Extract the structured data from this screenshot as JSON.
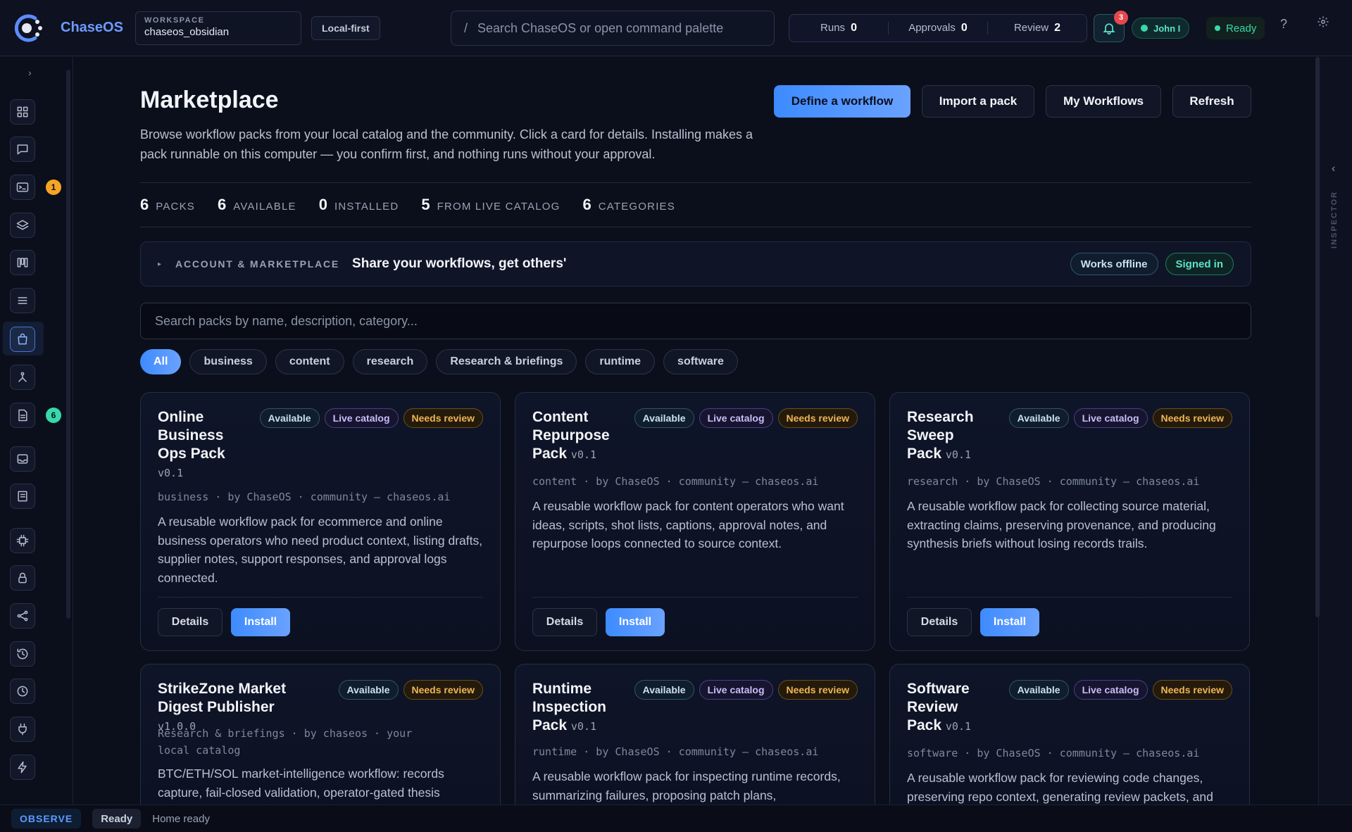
{
  "app": {
    "name": "ChaseOS"
  },
  "workspace": {
    "label": "WORKSPACE",
    "value": "chaseos_obsidian"
  },
  "mode_pill": "Local-first",
  "command": {
    "slash": "/",
    "placeholder": "Search ChaseOS or open command palette"
  },
  "counters": [
    {
      "label": "Runs",
      "value": "0"
    },
    {
      "label": "Approvals",
      "value": "0"
    },
    {
      "label": "Review",
      "value": "2"
    }
  ],
  "notifications": {
    "count": "3"
  },
  "user": {
    "name": "John I"
  },
  "status": {
    "label": "Ready"
  },
  "help": "?",
  "sidebar": {
    "toggle": "›",
    "items": [
      {
        "icon": "grid-icon"
      },
      {
        "icon": "chat-icon"
      },
      {
        "icon": "terminal-icon",
        "badge": "1",
        "badge_color": "#f5a524"
      },
      {
        "icon": "layers-icon"
      },
      {
        "icon": "kanban-icon"
      },
      {
        "icon": "list-icon"
      },
      {
        "icon": "shopping-bag-icon",
        "active": true
      },
      {
        "icon": "graph-icon"
      },
      {
        "icon": "document-icon",
        "badge": "6",
        "badge_color": "#38d9a9"
      },
      {
        "icon": "inbox-icon"
      },
      {
        "icon": "notebook-icon"
      },
      {
        "icon": "chip-icon"
      },
      {
        "icon": "lock-icon"
      },
      {
        "icon": "share-icon"
      },
      {
        "icon": "history-icon"
      },
      {
        "icon": "clock-icon"
      },
      {
        "icon": "plug-icon"
      },
      {
        "icon": "bolt-icon"
      }
    ]
  },
  "inspector": {
    "label": "INSPECTOR",
    "collapse": "‹"
  },
  "page": {
    "title": "Marketplace",
    "description": "Browse workflow packs from your local catalog and the community. Click a card for details. Installing makes a pack runnable on this computer — you confirm first, and nothing runs without your approval.",
    "actions": {
      "define": "Define a workflow",
      "import": "Import a pack",
      "my": "My Workflows",
      "refresh": "Refresh"
    },
    "stats": [
      {
        "value": "6",
        "label": "PACKS"
      },
      {
        "value": "6",
        "label": "AVAILABLE"
      },
      {
        "value": "0",
        "label": "INSTALLED"
      },
      {
        "value": "5",
        "label": "FROM LIVE CATALOG"
      },
      {
        "value": "6",
        "label": "CATEGORIES"
      }
    ],
    "account": {
      "caret": "▸",
      "label": "ACCOUNT & MARKETPLACE",
      "title": "Share your workflows, get others'",
      "tags": [
        "Works offline",
        "Signed in"
      ]
    },
    "search_placeholder": "Search packs by name, description, category...",
    "filters": [
      "All",
      "business",
      "content",
      "research",
      "Research & briefings",
      "runtime",
      "software"
    ],
    "active_filter": "All"
  },
  "cards": [
    {
      "title": "Online Business Ops Pack",
      "version": "v0.1",
      "badges": [
        "Available",
        "Live catalog",
        "Needs review"
      ],
      "meta": "business · by ChaseOS · community — chaseos.ai",
      "description": "A reusable workflow pack for ecommerce and online business operators who need product context, listing drafts, supplier notes, support responses, and approval logs connected.",
      "details_label": "Details",
      "install_label": "Install"
    },
    {
      "title": "Content Repurpose Pack",
      "version": "v0.1",
      "badges": [
        "Available",
        "Live catalog",
        "Needs review"
      ],
      "meta": "content · by ChaseOS · community — chaseos.ai",
      "description": "A reusable workflow pack for content operators who want ideas, scripts, shot lists, captions, approval notes, and repurpose loops connected to source context.",
      "details_label": "Details",
      "install_label": "Install"
    },
    {
      "title": "Research Sweep Pack",
      "version": "v0.1",
      "badges": [
        "Available",
        "Live catalog",
        "Needs review"
      ],
      "meta": "research · by ChaseOS · community — chaseos.ai",
      "description": "A reusable workflow pack for collecting source material, extracting claims, preserving provenance, and producing synthesis briefs without losing records trails.",
      "details_label": "Details",
      "install_label": "Install"
    },
    {
      "title": "StrikeZone Market Digest Publisher",
      "version": "v1.0.0",
      "badges": [
        "Available",
        "Needs review"
      ],
      "meta": "Research & briefings · by chaseos · your local catalog",
      "description": "BTC/ETH/SOL market-intelligence workflow: records capture, fail-closed validation, operator-gated thesis"
    },
    {
      "title": "Runtime Inspection Pack",
      "version": "v0.1",
      "badges": [
        "Available",
        "Live catalog",
        "Needs review"
      ],
      "meta": "runtime · by ChaseOS · community — chaseos.ai",
      "description": "A reusable workflow pack for inspecting runtime records, summarizing failures, proposing patch plans,"
    },
    {
      "title": "Software Review Pack",
      "version": "v0.1",
      "badges": [
        "Available",
        "Live catalog",
        "Needs review"
      ],
      "meta": "software · by ChaseOS · community — chaseos.ai",
      "description": "A reusable workflow pack for reviewing code changes, preserving repo context, generating review packets, and"
    }
  ],
  "statusbar": {
    "mode": "OBSERVE",
    "state": "Ready",
    "message": "Home ready"
  }
}
